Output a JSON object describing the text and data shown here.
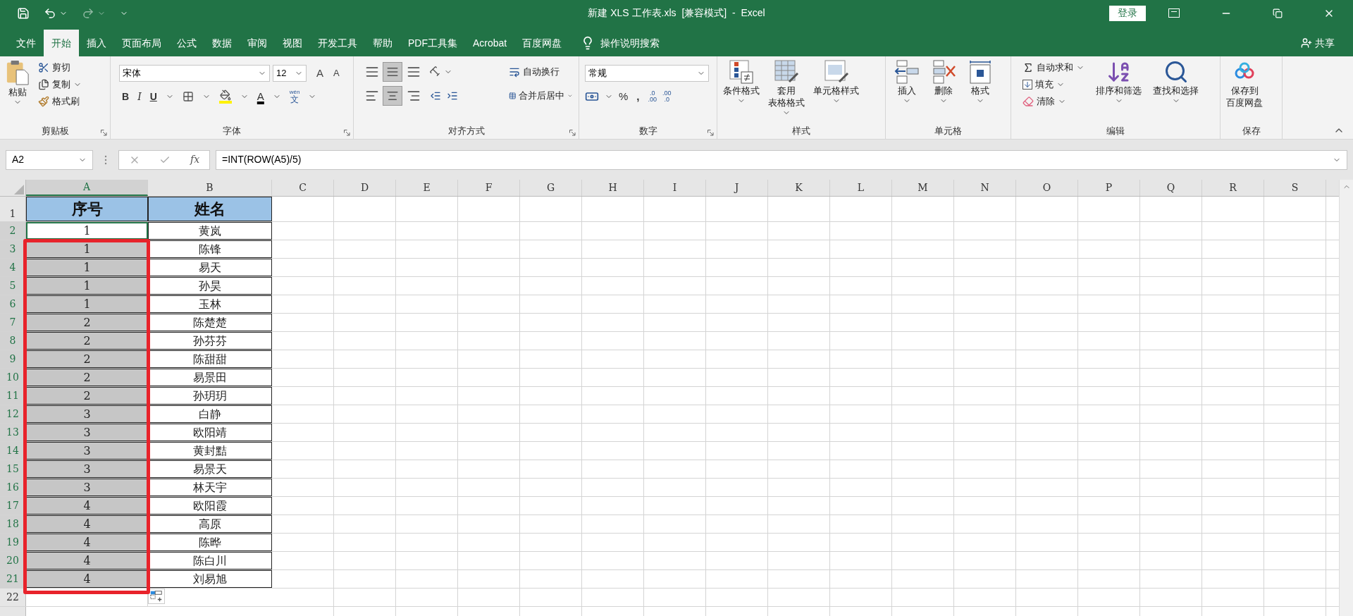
{
  "title_bar": {
    "title": "新建 XLS 工作表.xls  [兼容模式]  -  Excel",
    "login": "登录"
  },
  "menu_tabs": [
    {
      "label": "文件",
      "selected": false
    },
    {
      "label": "开始",
      "selected": true
    },
    {
      "label": "插入",
      "selected": false
    },
    {
      "label": "页面布局",
      "selected": false
    },
    {
      "label": "公式",
      "selected": false
    },
    {
      "label": "数据",
      "selected": false
    },
    {
      "label": "审阅",
      "selected": false
    },
    {
      "label": "视图",
      "selected": false
    },
    {
      "label": "开发工具",
      "selected": false
    },
    {
      "label": "帮助",
      "selected": false
    },
    {
      "label": "PDF工具集",
      "selected": false
    },
    {
      "label": "Acrobat",
      "selected": false
    },
    {
      "label": "百度网盘",
      "selected": false
    }
  ],
  "tell_me": "操作说明搜索",
  "share": "共享",
  "ribbon": {
    "clipboard": {
      "label": "剪贴板",
      "paste": "粘贴",
      "cut": "剪切",
      "copy": "复制",
      "format_painter": "格式刷"
    },
    "font": {
      "label": "字体",
      "font_name": "宋体",
      "font_size": "12",
      "grow": "A",
      "shrink": "A",
      "bold": "B",
      "italic": "I",
      "underline": "U",
      "font_color": "A",
      "phonetic_top": "wén",
      "phonetic": "文"
    },
    "alignment": {
      "label": "对齐方式",
      "wrap": "自动换行",
      "merge": "合并后居中"
    },
    "number": {
      "label": "数字",
      "format": "常规",
      "percent": "%",
      "comma": ",",
      "increase_decimal": [
        ".0",
        ".00"
      ],
      "decrease_decimal": [
        ".00",
        ".0"
      ]
    },
    "styles": {
      "label": "样式",
      "conditional": "条件格式",
      "table": [
        "套用",
        "表格格式"
      ],
      "cell_styles": "单元格样式"
    },
    "cells": {
      "label": "单元格",
      "insert": "插入",
      "delete": "删除",
      "format": "格式"
    },
    "editing": {
      "label": "编辑",
      "autosum": "自动求和",
      "fill": "填充",
      "clear": "清除",
      "sort": "排序和筛选",
      "find": "查找和选择"
    },
    "save": {
      "label": "保存",
      "save_to": [
        "保存到",
        "百度网盘"
      ]
    }
  },
  "formula_bar": {
    "name_box": "A2",
    "fx": "fx",
    "formula": "=INT(ROW(A5)/5)"
  },
  "sheet": {
    "columns": [
      {
        "label": "A",
        "selected": true
      },
      {
        "label": "B",
        "selected": false
      },
      {
        "label": "C",
        "selected": false
      },
      {
        "label": "D",
        "selected": false
      },
      {
        "label": "E",
        "selected": false
      },
      {
        "label": "F",
        "selected": false
      },
      {
        "label": "G",
        "selected": false
      },
      {
        "label": "H",
        "selected": false
      },
      {
        "label": "I",
        "selected": false
      },
      {
        "label": "J",
        "selected": false
      },
      {
        "label": "K",
        "selected": false
      },
      {
        "label": "L",
        "selected": false
      },
      {
        "label": "M",
        "selected": false
      },
      {
        "label": "N",
        "selected": false
      },
      {
        "label": "O",
        "selected": false
      },
      {
        "label": "P",
        "selected": false
      },
      {
        "label": "Q",
        "selected": false
      },
      {
        "label": "R",
        "selected": false
      },
      {
        "label": "S",
        "selected": false
      }
    ],
    "header_row": {
      "number": "1",
      "cells": [
        "序号",
        "姓名"
      ]
    },
    "rows": [
      {
        "number": "2",
        "selected": true,
        "active": true,
        "cells": [
          "1",
          "黄岚"
        ]
      },
      {
        "number": "3",
        "selected": true,
        "active": false,
        "cells": [
          "1",
          "陈锋"
        ]
      },
      {
        "number": "4",
        "selected": true,
        "active": false,
        "cells": [
          "1",
          "易天"
        ]
      },
      {
        "number": "5",
        "selected": true,
        "active": false,
        "cells": [
          "1",
          "孙昊"
        ]
      },
      {
        "number": "6",
        "selected": true,
        "active": false,
        "cells": [
          "1",
          "玉林"
        ]
      },
      {
        "number": "7",
        "selected": true,
        "active": false,
        "cells": [
          "2",
          "陈楚楚"
        ]
      },
      {
        "number": "8",
        "selected": true,
        "active": false,
        "cells": [
          "2",
          "孙芬芬"
        ]
      },
      {
        "number": "9",
        "selected": true,
        "active": false,
        "cells": [
          "2",
          "陈甜甜"
        ]
      },
      {
        "number": "10",
        "selected": true,
        "active": false,
        "cells": [
          "2",
          "易景田"
        ]
      },
      {
        "number": "11",
        "selected": true,
        "active": false,
        "cells": [
          "2",
          "孙玥玥"
        ]
      },
      {
        "number": "12",
        "selected": true,
        "active": false,
        "cells": [
          "3",
          "白静"
        ]
      },
      {
        "number": "13",
        "selected": true,
        "active": false,
        "cells": [
          "3",
          "欧阳靖"
        ]
      },
      {
        "number": "14",
        "selected": true,
        "active": false,
        "cells": [
          "3",
          "黄封黠"
        ]
      },
      {
        "number": "15",
        "selected": true,
        "active": false,
        "cells": [
          "3",
          "易景天"
        ]
      },
      {
        "number": "16",
        "selected": true,
        "active": false,
        "cells": [
          "3",
          "林天宇"
        ]
      },
      {
        "number": "17",
        "selected": true,
        "active": false,
        "cells": [
          "4",
          "欧阳霞"
        ]
      },
      {
        "number": "18",
        "selected": true,
        "active": false,
        "cells": [
          "4",
          "高原"
        ]
      },
      {
        "number": "19",
        "selected": true,
        "active": false,
        "cells": [
          "4",
          "陈晔"
        ]
      },
      {
        "number": "20",
        "selected": true,
        "active": false,
        "cells": [
          "4",
          "陈白川"
        ]
      },
      {
        "number": "21",
        "selected": true,
        "active": false,
        "cells": [
          "4",
          "刘易旭"
        ]
      }
    ],
    "empty_rows": [
      {
        "number": "22"
      }
    ]
  }
}
